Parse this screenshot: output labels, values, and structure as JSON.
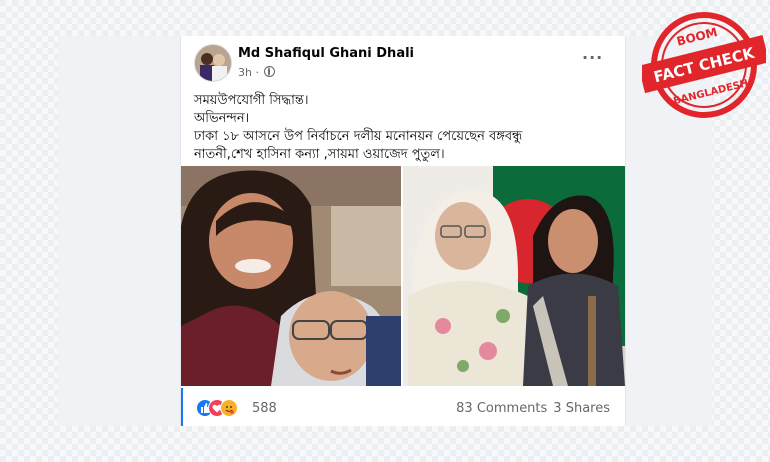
{
  "post": {
    "author": "Md Shafiqul Ghani Dhali",
    "time": "3h",
    "privacy_icon": "globe-icon",
    "more_icon": "more-icon",
    "lines": [
      "সময়উপযোগী সিদ্ধান্ত।",
      " অভিনন্দন।",
      "ঢাকা ১৮ আসনে উপ নির্বাচনে দলীয় মনোনয়ন পেয়েছেন বঙ্গবন্ধু",
      "নাতনী,শেখ হাসিনা কন্যা ,সায়মা ওয়াজেদ পুতুল।"
    ],
    "reactions": [
      "like-icon",
      "love-icon",
      "care-icon"
    ],
    "reaction_count": "588",
    "comments": "83 Comments",
    "shares": "3 Shares"
  },
  "badge": {
    "top": "BOOM",
    "main": "FACT CHECK",
    "bottom": "BANGLADESH",
    "color": "#e0262b"
  },
  "colors": {
    "facebook_blue": "#1877f2",
    "love_red": "#f33e58",
    "haha_yellow": "#f7b125"
  }
}
